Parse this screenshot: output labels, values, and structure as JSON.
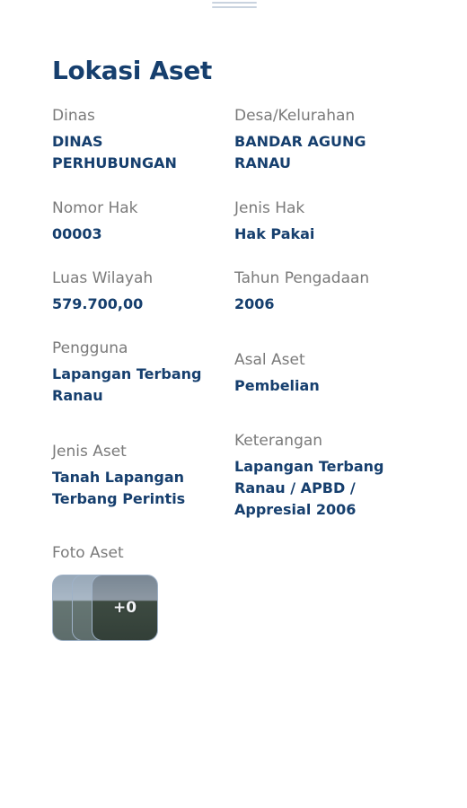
{
  "title": "Lokasi Aset",
  "fields": {
    "dinas": {
      "label": "Dinas",
      "value": "DINAS PERHUBUNGAN"
    },
    "desa": {
      "label": "Desa/Kelurahan",
      "value": "BANDAR AGUNG RANAU"
    },
    "nomor_hak": {
      "label": "Nomor Hak",
      "value": "00003"
    },
    "jenis_hak": {
      "label": "Jenis Hak",
      "value": "Hak Pakai"
    },
    "luas": {
      "label": "Luas Wilayah",
      "value": "579.700,00"
    },
    "tahun": {
      "label": "Tahun Pengadaan",
      "value": "2006"
    },
    "pengguna": {
      "label": "Pengguna",
      "value": "Lapangan Terbang Ranau"
    },
    "asal": {
      "label": "Asal Aset",
      "value": "Pembelian"
    },
    "jenis_aset": {
      "label": "Jenis Aset",
      "value": "Tanah Lapangan Terbang Perintis"
    },
    "keterangan": {
      "label": "Keterangan",
      "value": "Lapangan Terbang Ranau / APBD / Appresial 2006"
    }
  },
  "photos": {
    "label": "Foto Aset",
    "more_count": "+0"
  }
}
